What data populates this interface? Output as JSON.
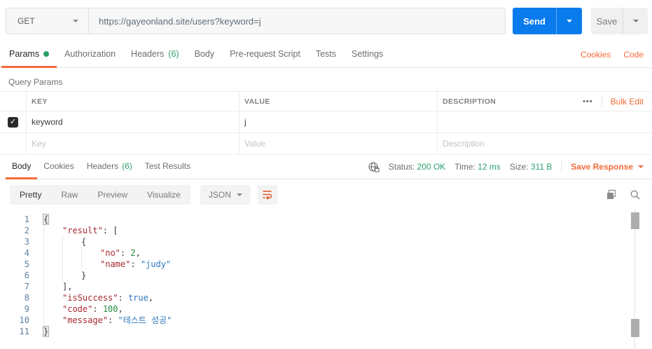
{
  "request_bar": {
    "method": "GET",
    "url": "https://gayeonland.site/users?keyword=j",
    "send_label": "Send",
    "save_label": "Save"
  },
  "request_tabs": {
    "params": "Params",
    "authorization": "Authorization",
    "headers": "Headers",
    "headers_count": "(6)",
    "body": "Body",
    "pre_request_script": "Pre-request Script",
    "tests": "Tests",
    "settings": "Settings",
    "cookies_link": "Cookies",
    "code_link": "Code"
  },
  "query_params": {
    "title": "Query Params",
    "columns": {
      "key": "KEY",
      "value": "VALUE",
      "description": "DESCRIPTION"
    },
    "more_icon": "•••",
    "bulk_edit": "Bulk Edit",
    "rows": [
      {
        "checked": true,
        "key": "keyword",
        "value": "j",
        "description": ""
      }
    ],
    "placeholder_row": {
      "key": "Key",
      "value": "Value",
      "description": "Description"
    }
  },
  "response_meta": {
    "tabs": {
      "body": "Body",
      "cookies": "Cookies",
      "headers": "Headers",
      "headers_count": "(6)",
      "test_results": "Test Results"
    },
    "status_label": "Status:",
    "status_value": "200 OK",
    "time_label": "Time:",
    "time_value": "12 ms",
    "size_label": "Size:",
    "size_value": "311 B",
    "save_response": "Save Response"
  },
  "response_toolbar": {
    "views": [
      "Pretty",
      "Raw",
      "Preview",
      "Visualize"
    ],
    "active_view": "Pretty",
    "format": "JSON"
  },
  "response_body": {
    "language": "json",
    "raw_text": "{ \"result\": [ { \"no\": 2, \"name\": \"judy\" } ], \"isSuccess\": true, \"code\": 100, \"message\": \"테스트 성공\" }",
    "lines": [
      {
        "n": 1,
        "indent": 0,
        "tokens": [
          {
            "t": "brace-hl",
            "v": "{"
          }
        ]
      },
      {
        "n": 2,
        "indent": 1,
        "tokens": [
          {
            "t": "key",
            "v": "\"result\""
          },
          {
            "t": "punct",
            "v": ": ["
          }
        ]
      },
      {
        "n": 3,
        "indent": 2,
        "tokens": [
          {
            "t": "punct",
            "v": "{"
          }
        ]
      },
      {
        "n": 4,
        "indent": 3,
        "tokens": [
          {
            "t": "key",
            "v": "\"no\""
          },
          {
            "t": "punct",
            "v": ": "
          },
          {
            "t": "num",
            "v": "2"
          },
          {
            "t": "punct",
            "v": ","
          }
        ]
      },
      {
        "n": 5,
        "indent": 3,
        "tokens": [
          {
            "t": "key",
            "v": "\"name\""
          },
          {
            "t": "punct",
            "v": ": "
          },
          {
            "t": "str",
            "v": "\"judy\""
          }
        ]
      },
      {
        "n": 6,
        "indent": 2,
        "tokens": [
          {
            "t": "punct",
            "v": "}"
          }
        ]
      },
      {
        "n": 7,
        "indent": 1,
        "tokens": [
          {
            "t": "punct",
            "v": "],"
          }
        ]
      },
      {
        "n": 8,
        "indent": 1,
        "tokens": [
          {
            "t": "key",
            "v": "\"isSuccess\""
          },
          {
            "t": "punct",
            "v": ": "
          },
          {
            "t": "bool",
            "v": "true"
          },
          {
            "t": "punct",
            "v": ","
          }
        ]
      },
      {
        "n": 9,
        "indent": 1,
        "tokens": [
          {
            "t": "key",
            "v": "\"code\""
          },
          {
            "t": "punct",
            "v": ": "
          },
          {
            "t": "num",
            "v": "100"
          },
          {
            "t": "punct",
            "v": ","
          }
        ]
      },
      {
        "n": 10,
        "indent": 1,
        "tokens": [
          {
            "t": "key",
            "v": "\"message\""
          },
          {
            "t": "punct",
            "v": ": "
          },
          {
            "t": "str",
            "v": "\"테스트 성공\""
          }
        ]
      },
      {
        "n": 11,
        "indent": 0,
        "tokens": [
          {
            "t": "brace-hl",
            "v": "}"
          }
        ]
      }
    ]
  },
  "colors": {
    "accent_orange": "#f26b3a",
    "success_green": "#2ba06a",
    "send_blue": "#097bed",
    "json_key": "#a5282e",
    "json_string": "#2e77bc",
    "json_number": "#258a3e",
    "line_number": "#5b7e9f"
  },
  "icons": {
    "method_caret": "chevron-down",
    "more": "three-dots-menu",
    "globe_lock": "globe-with-lock",
    "wrap": "wrap-text",
    "copy": "copy",
    "search": "magnifier"
  }
}
